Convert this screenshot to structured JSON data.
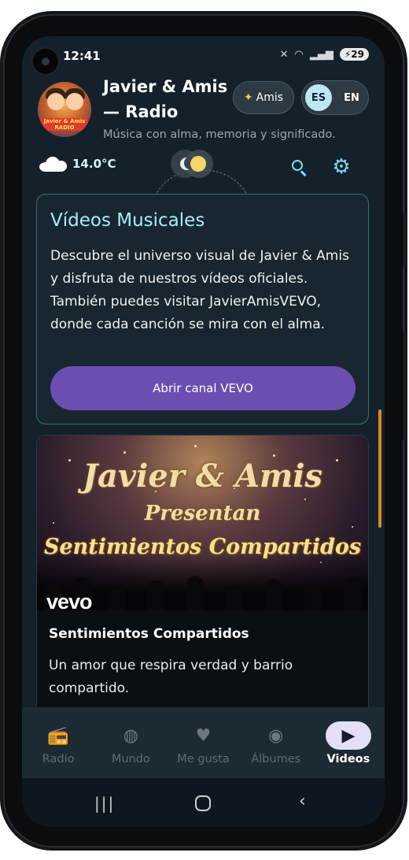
{
  "status_bar": {
    "time": "12:41",
    "battery": "29"
  },
  "header": {
    "title": "Javier & Amis — Radio",
    "subtitle": "Música con alma, memoria y significado.",
    "logo_text": "Javier & Amis RADIO",
    "amis_button": "Amis",
    "lang_es": "ES",
    "lang_en": "EN"
  },
  "weather": {
    "temperature": "14.0°C",
    "icon": "cloud-icon"
  },
  "videos_card": {
    "title": "Vídeos Musicales",
    "description": "Descubre el universo visual de Javier & Amis y disfruta de nuestros vídeos oficiales. También puedes visitar JavierAmisVEVO, donde cada canción se mira con el alma.",
    "button_label": "Abrir canal VEVO"
  },
  "video_item": {
    "thumbnail_line1": "Javier & Amis",
    "thumbnail_line2": "Presentan",
    "thumbnail_line3": "Sentimientos Compartidos",
    "vevo_logo": "vevo",
    "title": "Sentimientos Compartidos",
    "description": "Un amor que respira verdad y barrio compartido."
  },
  "bottom_nav": {
    "items": [
      {
        "label": "Radio",
        "icon": "radio-icon"
      },
      {
        "label": "Mundo",
        "icon": "globe-icon"
      },
      {
        "label": "Me gusta",
        "icon": "heart-icon"
      },
      {
        "label": "Álbumes",
        "icon": "disc-icon"
      },
      {
        "label": "Videos",
        "icon": "video-library-icon"
      }
    ],
    "active_index": 4
  },
  "colors": {
    "background": "#14212a",
    "accent_cyan": "#7fd9f5",
    "primary_button": "#6a4fb0",
    "card_border": "#3f6e72",
    "scroll_indicator": "#d98a2d"
  }
}
